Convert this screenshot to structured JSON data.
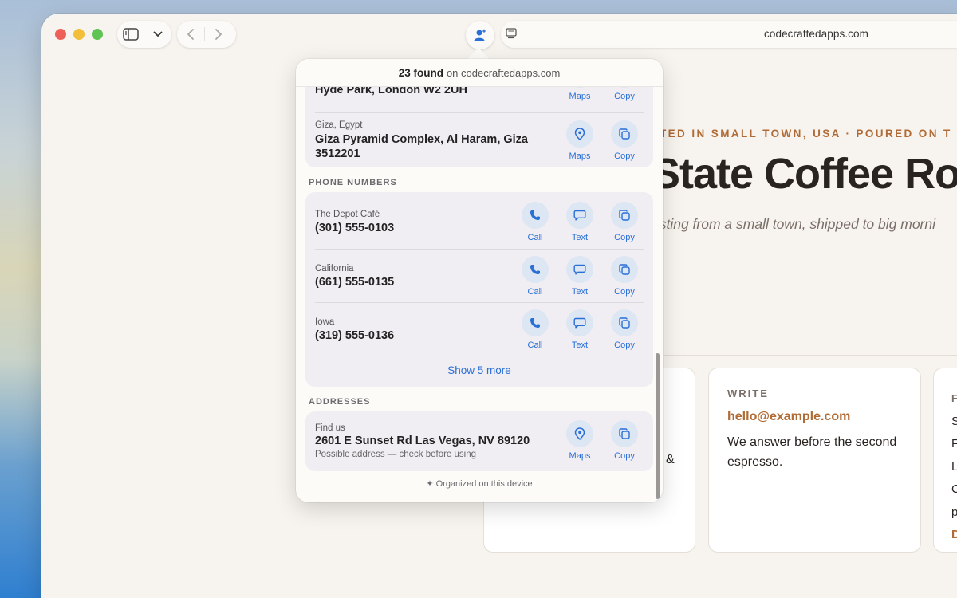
{
  "toolbar": {
    "url": "codecraftedapps.com"
  },
  "page": {
    "tagline": "TED IN SMALL TOWN, USA · POURED ON T",
    "hero_title": "State Coffee Ro",
    "subline": "asting from a small town, shipped to big morni",
    "card1_fragment": "&",
    "write_card": {
      "label": "WRITE",
      "email": "hello@example.com",
      "body": "We answer before the second espresso."
    },
    "card3_fragment": {
      "label": "F",
      "lines": [
        "S",
        "F",
        "L",
        "C",
        "p"
      ],
      "accent": "D"
    }
  },
  "popover": {
    "count": "23 found",
    "site": "on codecraftedapps.com",
    "partial_address": {
      "value": "Hyde Park, London W2 2UH",
      "actions": [
        "Maps",
        "Copy"
      ]
    },
    "giza": {
      "label": "Giza, Egypt",
      "value_line1": "Giza Pyramid Complex, Al Haram, Giza",
      "value_line2": "3512201",
      "actions": [
        "Maps",
        "Copy"
      ]
    },
    "phone_section_title": "PHONE NUMBERS",
    "phones": [
      {
        "label": "The Depot Café",
        "value": "(301) 555-0103",
        "actions": [
          "Call",
          "Text",
          "Copy"
        ]
      },
      {
        "label": "California",
        "value": "(661) 555-0135",
        "actions": [
          "Call",
          "Text",
          "Copy"
        ]
      },
      {
        "label": "Iowa",
        "value": "(319) 555-0136",
        "actions": [
          "Call",
          "Text",
          "Copy"
        ]
      }
    ],
    "show_more": "Show 5 more",
    "address_section_title": "ADDRESSES",
    "address": {
      "label": "Find us",
      "value": "2601 E Sunset Rd Las Vegas, NV 89120",
      "note": "Possible address — check before using",
      "actions": [
        "Maps",
        "Copy"
      ]
    },
    "footer": "✦ Organized on this device"
  },
  "colors": {
    "accent": "#2a6fd6",
    "brand": "#b06b36",
    "traffic_red": "#ee5f57",
    "traffic_yellow": "#f3bf3a",
    "traffic_green": "#5fc453"
  }
}
